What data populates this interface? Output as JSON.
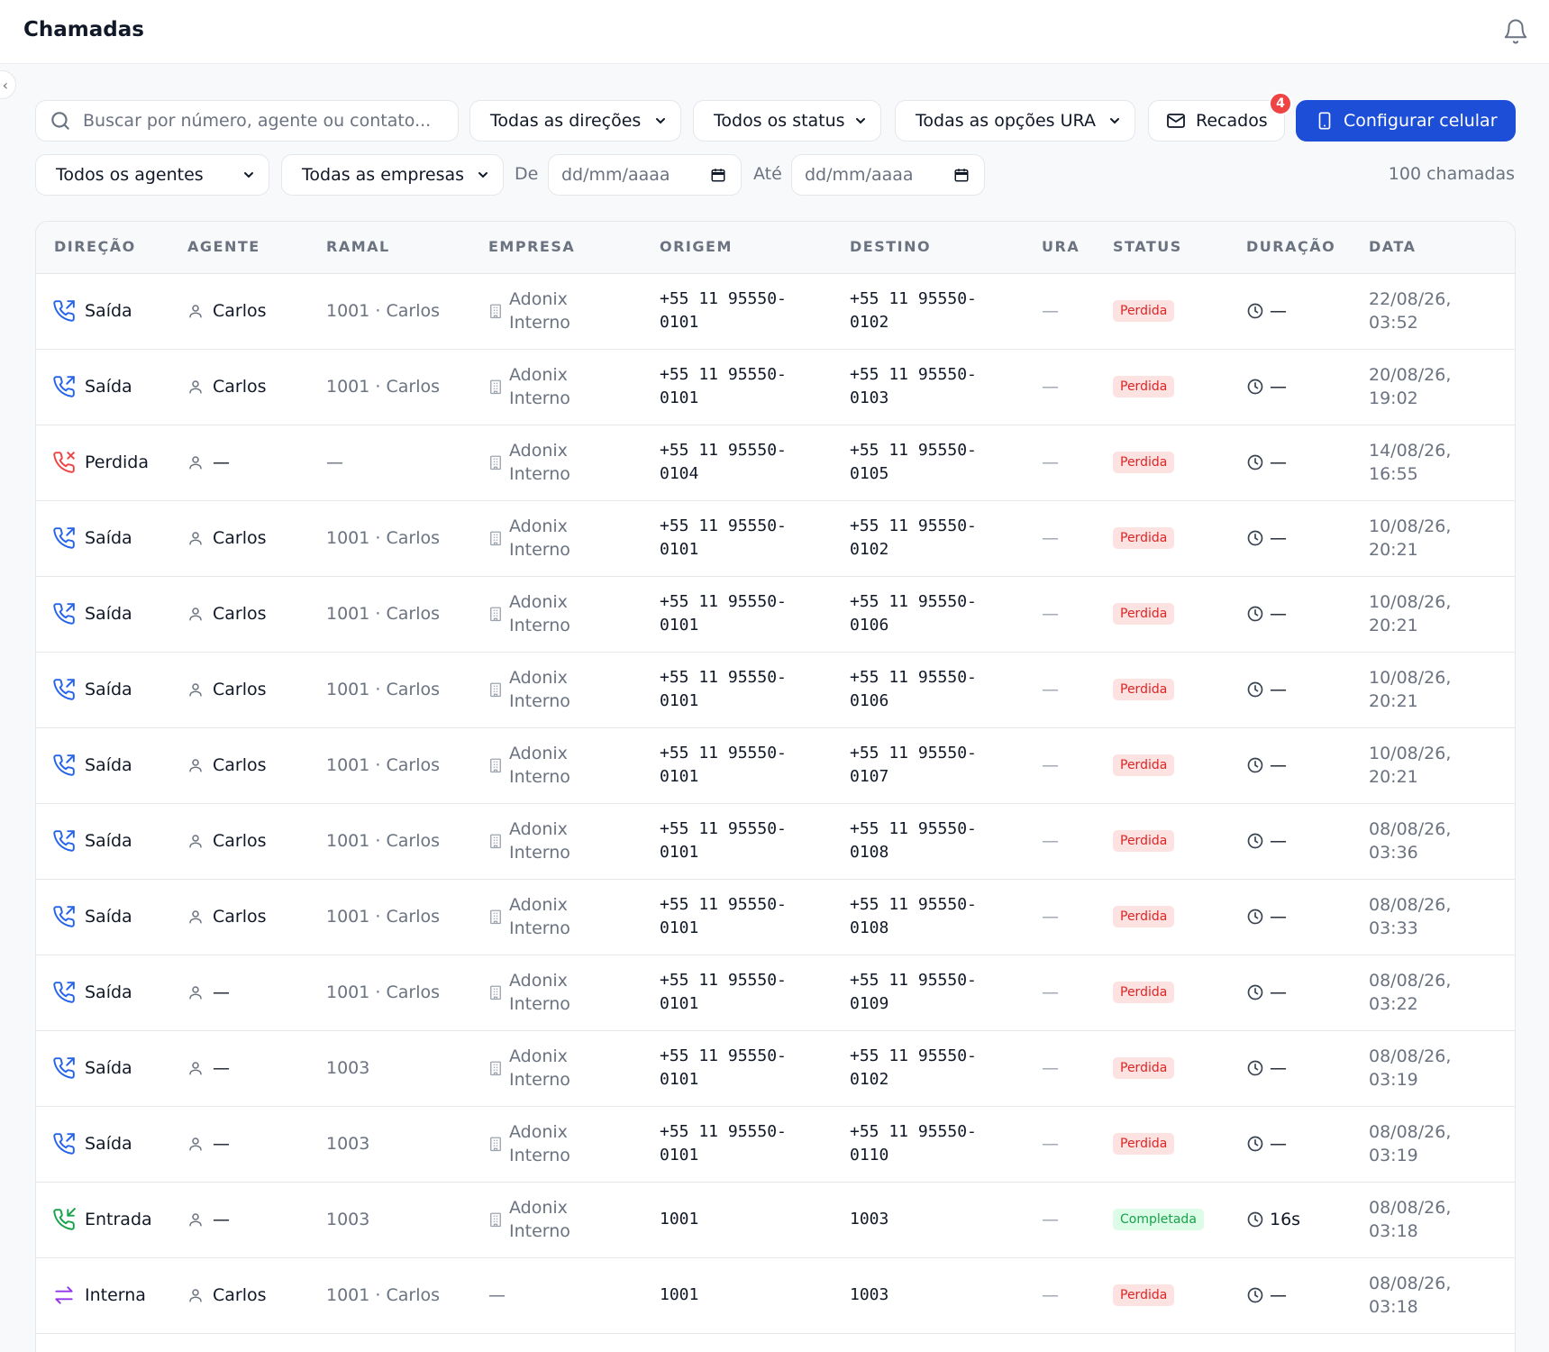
{
  "header": {
    "title": "Chamadas"
  },
  "filters": {
    "search_placeholder": "Buscar por número, agente ou contato...",
    "direction": "Todas as direções",
    "status": "Todos os status",
    "ura": "Todas as opções URA",
    "recados_label": "Recados",
    "recados_count": "4",
    "config_label": "Configurar celular",
    "agents": "Todos os agentes",
    "companies": "Todas as empresas",
    "from_label": "De",
    "to_label": "Até",
    "date_placeholder": "dd/mm/aaaa",
    "count": "100 chamadas"
  },
  "table": {
    "headers": [
      "DIREÇÃO",
      "AGENTE",
      "RAMAL",
      "EMPRESA",
      "ORIGEM",
      "DESTINO",
      "URA",
      "STATUS",
      "DURAÇÃO",
      "DATA"
    ],
    "rows": [
      {
        "dir": "Saída",
        "type": "out",
        "agent": "Carlos",
        "ramal": "1001 · Carlos",
        "emp": "Adonix Interno",
        "orig": "+55 11 95550-0101",
        "dest": "+55 11 95550-0102",
        "ura": "—",
        "status": "Perdida",
        "dur": "—",
        "date": "22/08/26, 03:52"
      },
      {
        "dir": "Saída",
        "type": "out",
        "agent": "Carlos",
        "ramal": "1001 · Carlos",
        "emp": "Adonix Interno",
        "orig": "+55 11 95550-0101",
        "dest": "+55 11 95550-0103",
        "ura": "—",
        "status": "Perdida",
        "dur": "—",
        "date": "20/08/26, 19:02"
      },
      {
        "dir": "Perdida",
        "type": "missed",
        "agent": "—",
        "ramal": "—",
        "emp": "Adonix Interno",
        "orig": "+55 11 95550-0104",
        "dest": "+55 11 95550-0105",
        "ura": "—",
        "status": "Perdida",
        "dur": "—",
        "date": "14/08/26, 16:55"
      },
      {
        "dir": "Saída",
        "type": "out",
        "agent": "Carlos",
        "ramal": "1001 · Carlos",
        "emp": "Adonix Interno",
        "orig": "+55 11 95550-0101",
        "dest": "+55 11 95550-0102",
        "ura": "—",
        "status": "Perdida",
        "dur": "—",
        "date": "10/08/26, 20:21"
      },
      {
        "dir": "Saída",
        "type": "out",
        "agent": "Carlos",
        "ramal": "1001 · Carlos",
        "emp": "Adonix Interno",
        "orig": "+55 11 95550-0101",
        "dest": "+55 11 95550-0106",
        "ura": "—",
        "status": "Perdida",
        "dur": "—",
        "date": "10/08/26, 20:21"
      },
      {
        "dir": "Saída",
        "type": "out",
        "agent": "Carlos",
        "ramal": "1001 · Carlos",
        "emp": "Adonix Interno",
        "orig": "+55 11 95550-0101",
        "dest": "+55 11 95550-0106",
        "ura": "—",
        "status": "Perdida",
        "dur": "—",
        "date": "10/08/26, 20:21"
      },
      {
        "dir": "Saída",
        "type": "out",
        "agent": "Carlos",
        "ramal": "1001 · Carlos",
        "emp": "Adonix Interno",
        "orig": "+55 11 95550-0101",
        "dest": "+55 11 95550-0107",
        "ura": "—",
        "status": "Perdida",
        "dur": "—",
        "date": "10/08/26, 20:21"
      },
      {
        "dir": "Saída",
        "type": "out",
        "agent": "Carlos",
        "ramal": "1001 · Carlos",
        "emp": "Adonix Interno",
        "orig": "+55 11 95550-0101",
        "dest": "+55 11 95550-0108",
        "ura": "—",
        "status": "Perdida",
        "dur": "—",
        "date": "08/08/26, 03:36"
      },
      {
        "dir": "Saída",
        "type": "out",
        "agent": "Carlos",
        "ramal": "1001 · Carlos",
        "emp": "Adonix Interno",
        "orig": "+55 11 95550-0101",
        "dest": "+55 11 95550-0108",
        "ura": "—",
        "status": "Perdida",
        "dur": "—",
        "date": "08/08/26, 03:33"
      },
      {
        "dir": "Saída",
        "type": "out",
        "agent": "—",
        "ramal": "1001 · Carlos",
        "emp": "Adonix Interno",
        "orig": "+55 11 95550-0101",
        "dest": "+55 11 95550-0109",
        "ura": "—",
        "status": "Perdida",
        "dur": "—",
        "date": "08/08/26, 03:22"
      },
      {
        "dir": "Saída",
        "type": "out",
        "agent": "—",
        "ramal": "1003",
        "emp": "Adonix Interno",
        "orig": "+55 11 95550-0101",
        "dest": "+55 11 95550-0102",
        "ura": "—",
        "status": "Perdida",
        "dur": "—",
        "date": "08/08/26, 03:19"
      },
      {
        "dir": "Saída",
        "type": "out",
        "agent": "—",
        "ramal": "1003",
        "emp": "Adonix Interno",
        "orig": "+55 11 95550-0101",
        "dest": "+55 11 95550-0110",
        "ura": "—",
        "status": "Perdida",
        "dur": "—",
        "date": "08/08/26, 03:19"
      },
      {
        "dir": "Entrada",
        "type": "in",
        "agent": "—",
        "ramal": "1003",
        "emp": "Adonix Interno",
        "orig": "1001",
        "dest": "1003",
        "ura": "—",
        "status": "Completada",
        "dur": "16s",
        "date": "08/08/26, 03:18"
      },
      {
        "dir": "Interna",
        "type": "internal",
        "agent": "Carlos",
        "ramal": "1001 · Carlos",
        "emp": "—",
        "orig": "1001",
        "dest": "1003",
        "ura": "—",
        "status": "Perdida",
        "dur": "—",
        "date": "08/08/26, 03:18"
      }
    ]
  },
  "colors": {
    "primary": "#1d4ed8",
    "outgoing": "#2563eb",
    "missed": "#ef4444",
    "incoming": "#16a34a",
    "internal": "#9333ea"
  }
}
